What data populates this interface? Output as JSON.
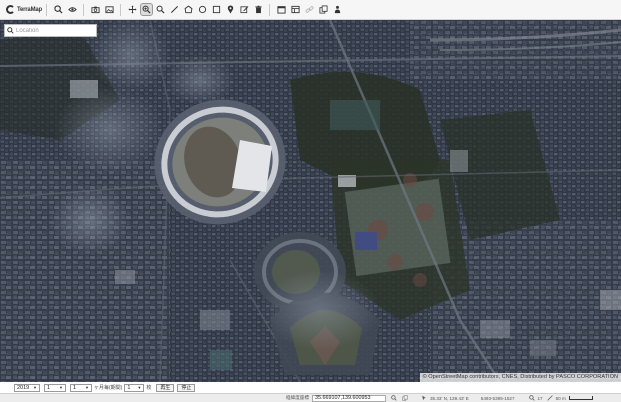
{
  "app": {
    "logo_text": "TerraMap"
  },
  "toolbar": {
    "tools": [
      {
        "name": "search-tool",
        "icon": "magnifier-icon"
      },
      {
        "name": "view-tool",
        "icon": "eye-icon"
      },
      {
        "name": "camera-tool",
        "icon": "camera-icon"
      },
      {
        "name": "image-tool",
        "icon": "image-icon"
      },
      {
        "name": "pan-tool",
        "icon": "move-icon"
      },
      {
        "name": "zoom-box-tool",
        "icon": "zoom-box-icon",
        "active": true
      },
      {
        "name": "zoom-tool",
        "icon": "zoom-icon"
      },
      {
        "name": "line-tool",
        "icon": "line-icon"
      },
      {
        "name": "polygon-tool",
        "icon": "polygon-icon"
      },
      {
        "name": "circle-tool",
        "icon": "circle-icon"
      },
      {
        "name": "rectangle-tool",
        "icon": "rectangle-icon"
      },
      {
        "name": "marker-tool",
        "icon": "pin-icon"
      },
      {
        "name": "edit-tool",
        "icon": "edit-icon"
      },
      {
        "name": "delete-tool",
        "icon": "trash-icon"
      },
      {
        "name": "calendar-tool",
        "icon": "calendar-icon"
      },
      {
        "name": "layers-tool",
        "icon": "layers-icon"
      },
      {
        "name": "link-tool",
        "icon": "link-icon",
        "disabled": true
      },
      {
        "name": "copy-tool",
        "icon": "copy-icon"
      },
      {
        "name": "person-tool",
        "icon": "person-icon"
      }
    ]
  },
  "search": {
    "placeholder": "Location"
  },
  "map": {
    "attribution": "© OpenStreetMap contributors, CNES, Distributed by PASCO CORPORATION"
  },
  "timebar": {
    "year": "2019",
    "month": "1",
    "day": "1",
    "interval_label": "ヶ月毎(期間)",
    "interval_value": "1",
    "interval_unit": "枚",
    "play_label": "再生",
    "stop_label": "停止"
  },
  "status": {
    "coord_label": "経緯度座標",
    "coord_value": "35.669107,139.600953",
    "cursor_coord": "35.33' N, 139.43' E",
    "extra_code": "5493-5395-1527",
    "zoom_label": "17",
    "scale_label": "50 m"
  },
  "colors": {
    "toolbar_bg": "#f6f6f6",
    "map_dark": "#2e3542",
    "accent": "#333333"
  }
}
